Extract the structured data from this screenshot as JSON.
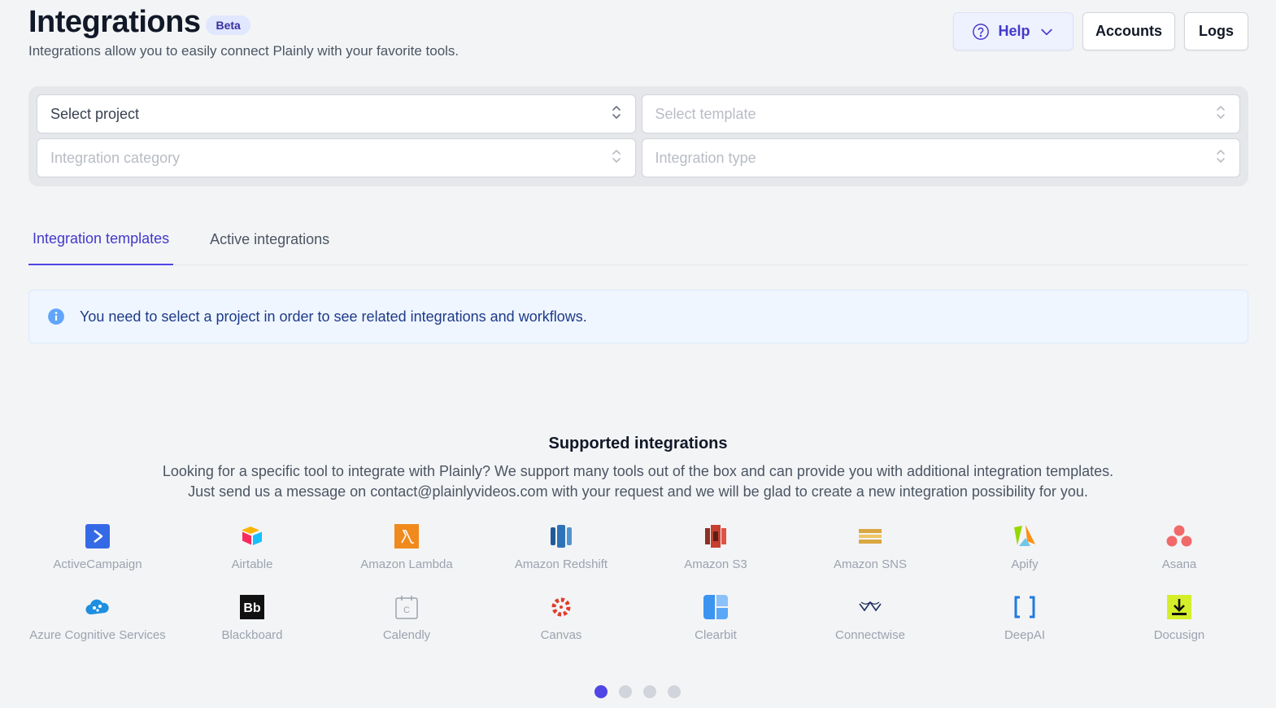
{
  "header": {
    "title": "Integrations",
    "badge": "Beta",
    "subtitle": "Integrations allow you to easily connect Plainly with your favorite tools."
  },
  "actions": {
    "help": "Help",
    "accounts": "Accounts",
    "logs": "Logs"
  },
  "filters": {
    "project": "Select project",
    "template": "Select template",
    "category": "Integration category",
    "type": "Integration type"
  },
  "tabs": [
    {
      "label": "Integration templates",
      "active": true
    },
    {
      "label": "Active integrations",
      "active": false
    }
  ],
  "alert": {
    "text": "You need to select a project in order to see related integrations and workflows.",
    "icon": "info-icon",
    "color": "#3b82f6"
  },
  "supported": {
    "title": "Supported integrations",
    "description": "Looking for a specific tool to integrate with Plainly? We support many tools out of the box and can provide you with additional integration templates. Just send us a message on contact@plainlyvideos.com with your request and we will be glad to create a new integration possibility for you."
  },
  "integrations": [
    {
      "name": "ActiveCampaign",
      "icon": "activecampaign-icon"
    },
    {
      "name": "Airtable",
      "icon": "airtable-icon"
    },
    {
      "name": "Amazon Lambda",
      "icon": "aws-lambda-icon"
    },
    {
      "name": "Amazon Redshift",
      "icon": "aws-redshift-icon"
    },
    {
      "name": "Amazon S3",
      "icon": "aws-s3-icon"
    },
    {
      "name": "Amazon SNS",
      "icon": "aws-sns-icon"
    },
    {
      "name": "Apify",
      "icon": "apify-icon"
    },
    {
      "name": "Asana",
      "icon": "asana-icon"
    },
    {
      "name": "Azure Cognitive Services",
      "icon": "azure-cognitive-icon"
    },
    {
      "name": "Blackboard",
      "icon": "blackboard-icon"
    },
    {
      "name": "Calendly",
      "icon": "calendly-icon"
    },
    {
      "name": "Canvas",
      "icon": "canvas-icon"
    },
    {
      "name": "Clearbit",
      "icon": "clearbit-icon"
    },
    {
      "name": "Connectwise",
      "icon": "connectwise-icon"
    },
    {
      "name": "DeepAI",
      "icon": "deepai-icon"
    },
    {
      "name": "Docusign",
      "icon": "docusign-icon"
    }
  ],
  "pagination": {
    "pages": 4,
    "current": 1
  }
}
